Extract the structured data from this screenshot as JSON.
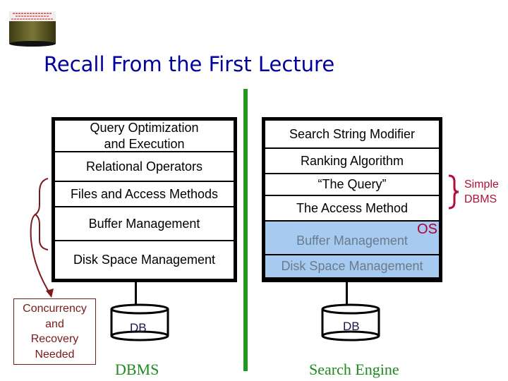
{
  "slide": {
    "title": "Recall From the First Lecture",
    "logo_icon": "database-cylinder-logo"
  },
  "left_stack": {
    "layers": [
      {
        "label": "Query Optimization\nand Execution"
      },
      {
        "label": "Relational Operators"
      },
      {
        "label": "Files and Access Methods"
      },
      {
        "label": "Buffer Management"
      },
      {
        "label": "Disk Space Management"
      }
    ],
    "db_label": "DB",
    "caption": "DBMS",
    "annotation": "Concurrency and Recovery Needed"
  },
  "right_stack": {
    "layers": [
      {
        "label": "Search String Modifier",
        "shaded": false
      },
      {
        "label": "Ranking Algorithm",
        "shaded": false
      },
      {
        "label": "“The Query”",
        "shaded": false
      },
      {
        "label": "The Access Method",
        "shaded": false
      },
      {
        "label": "Buffer Management",
        "shaded": true
      },
      {
        "label": "Disk Space Management",
        "shaded": true
      }
    ],
    "os_label": "OS",
    "db_label": "DB",
    "caption": "Search Engine",
    "brace_label": "Simple DBMS"
  },
  "annotation_lines": [
    "Concurrency",
    "and",
    "Recovery",
    "Needed"
  ],
  "simple_lines": [
    "Simple",
    "DBMS"
  ],
  "colors": {
    "title": "#00009c",
    "divider": "#1f9a1f",
    "caption": "#1f8a1f",
    "shaded_layer": "#a6caf0",
    "os_label": "#b0003a",
    "annotation": "#7a1a1a"
  }
}
